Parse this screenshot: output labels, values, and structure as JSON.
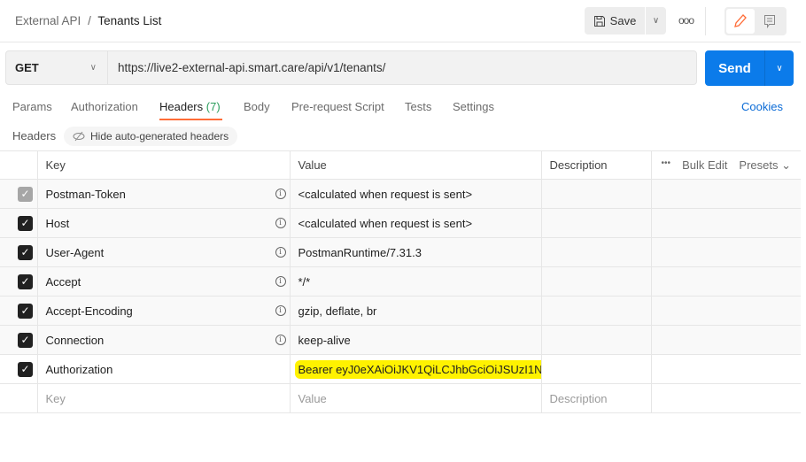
{
  "breadcrumb": {
    "parent": "External API",
    "separator": "/",
    "current": "Tenants List"
  },
  "toolbar": {
    "save": "Save",
    "more": "ooo"
  },
  "request": {
    "method": "GET",
    "url": "https://live2-external-api.smart.care/api/v1/tenants/",
    "send": "Send"
  },
  "tabs": [
    {
      "label": "Params"
    },
    {
      "label": "Authorization"
    },
    {
      "label": "Headers",
      "count": "(7)"
    },
    {
      "label": "Body"
    },
    {
      "label": "Pre-request Script"
    },
    {
      "label": "Tests"
    },
    {
      "label": "Settings"
    }
  ],
  "cookies": "Cookies",
  "headers_section": {
    "label": "Headers",
    "hide_button": "Hide auto-generated headers"
  },
  "table": {
    "columns": {
      "key": "Key",
      "value": "Value",
      "description": "Description",
      "more": "•••",
      "bulk_edit": "Bulk Edit",
      "presets": "Presets ⌄"
    },
    "rows": [
      {
        "key": "Postman-Token",
        "value": "<calculated when request is sent>"
      },
      {
        "key": "Host",
        "value": "<calculated when request is sent>"
      },
      {
        "key": "User-Agent",
        "value": "PostmanRuntime/7.31.3"
      },
      {
        "key": "Accept",
        "value": "*/*"
      },
      {
        "key": "Accept-Encoding",
        "value": "gzip, deflate, br"
      },
      {
        "key": "Connection",
        "value": "keep-alive"
      },
      {
        "key": "Authorization",
        "value": "Bearer eyJ0eXAiOiJKV1QiLCJhbGciOiJSUzI1N..."
      }
    ],
    "new_row": {
      "key_placeholder": "Key",
      "value_placeholder": "Value",
      "description_placeholder": "Description"
    }
  },
  "colors": {
    "accent": "#0b7bea",
    "tab_underline": "#ff6c37",
    "highlight": "#fff200"
  }
}
